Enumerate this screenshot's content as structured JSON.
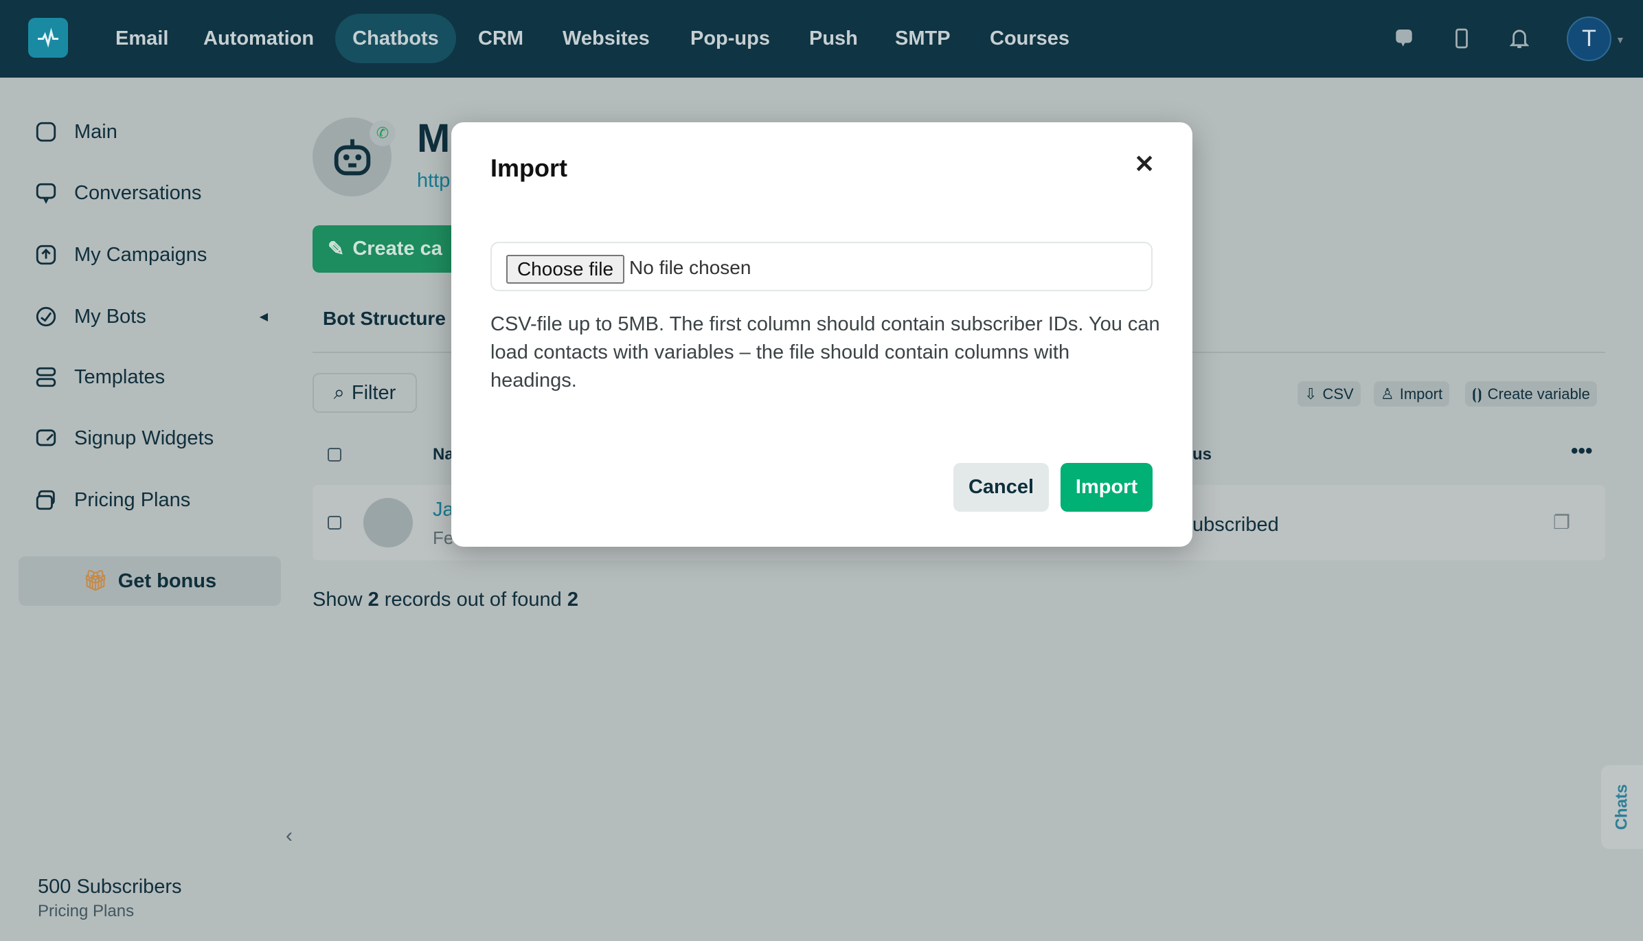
{
  "topnav": {
    "items": [
      "Email",
      "Automation",
      "Chatbots",
      "CRM",
      "Websites",
      "Pop-ups",
      "Push",
      "SMTP",
      "Courses"
    ],
    "active": "Chatbots",
    "avatar_letter": "T"
  },
  "sidebar": {
    "items": [
      {
        "label": "Main",
        "icon": "home-icon"
      },
      {
        "label": "Conversations",
        "icon": "chat-icon"
      },
      {
        "label": "My Campaigns",
        "icon": "upload-icon"
      },
      {
        "label": "My Bots",
        "icon": "bot-icon"
      },
      {
        "label": "Templates",
        "icon": "layers-icon"
      },
      {
        "label": "Signup Widgets",
        "icon": "widget-icon"
      },
      {
        "label": "Pricing Plans",
        "icon": "card-icon"
      }
    ],
    "bonus": "Get bonus",
    "subscribers": "500 Subscribers",
    "plan_link": "Pricing Plans"
  },
  "main": {
    "title_fragment": "M",
    "link_fragment": "http",
    "create_fragment": "Create ca",
    "tab": "Bot Structure",
    "filter": "Filter",
    "actions": {
      "csv": "CSV",
      "import": "Import",
      "create_variable": "Create variable"
    },
    "table": {
      "header_name_fragment": "Na",
      "header_status_fragment": "us",
      "row": {
        "name_fragment": "Ja",
        "sub_fragment": "Fe",
        "status_fragment": "ubscribed"
      }
    },
    "summary": {
      "prefix": "Show ",
      "shown": "2",
      "middle": " records out of found ",
      "total": "2"
    },
    "chats_tab": "Chats"
  },
  "modal": {
    "title": "Import",
    "choose_file": "Choose file",
    "no_file": "No file chosen",
    "description": "CSV-file up to 5MB. The first column should contain subscriber IDs. You can load contacts with variables – the file should contain columns with headings.",
    "cancel": "Cancel",
    "import": "Import"
  },
  "colors": {
    "topbar": "#0f3443",
    "accent_green": "#00b074",
    "link": "#1a8aa3"
  }
}
